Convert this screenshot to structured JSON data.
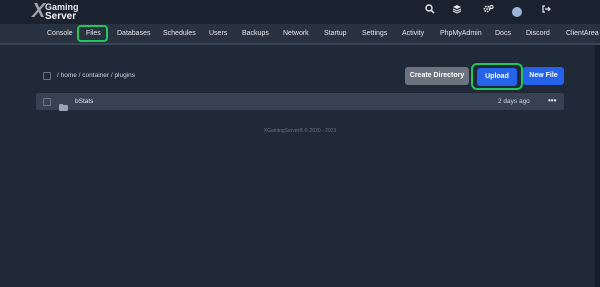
{
  "brand": {
    "mark": "X",
    "line1": "Gaming",
    "line2": "Server"
  },
  "top_icons": [
    "search-icon",
    "layers-icon",
    "gears-icon",
    "avatar",
    "logout-icon"
  ],
  "nav": {
    "items": [
      {
        "label": "Console"
      },
      {
        "label": "Files",
        "active": true
      },
      {
        "label": "Databases"
      },
      {
        "label": "Schedules"
      },
      {
        "label": "Users"
      },
      {
        "label": "Backups"
      },
      {
        "label": "Network"
      },
      {
        "label": "Startup"
      },
      {
        "label": "Settings"
      },
      {
        "label": "Activity"
      },
      {
        "label": "PhpMyAdmin"
      },
      {
        "label": "Docs"
      },
      {
        "label": "Discord"
      },
      {
        "label": "ClientArea"
      }
    ]
  },
  "files": {
    "breadcrumb": "/ home / container / plugins",
    "buttons": {
      "create_directory": "Create Directory",
      "upload": "Upload",
      "new_file": "New File"
    },
    "rows": [
      {
        "name": "bStats",
        "type": "folder",
        "modified": "2 days ago",
        "menu": "•••"
      }
    ]
  },
  "footer": "XGamingServer® © 2020 - 2023",
  "colors": {
    "background": "#1f2937",
    "navbar": "#283241",
    "primary_button": "#2563eb",
    "secondary_button": "#6b7280",
    "highlight": "#22c55e"
  }
}
